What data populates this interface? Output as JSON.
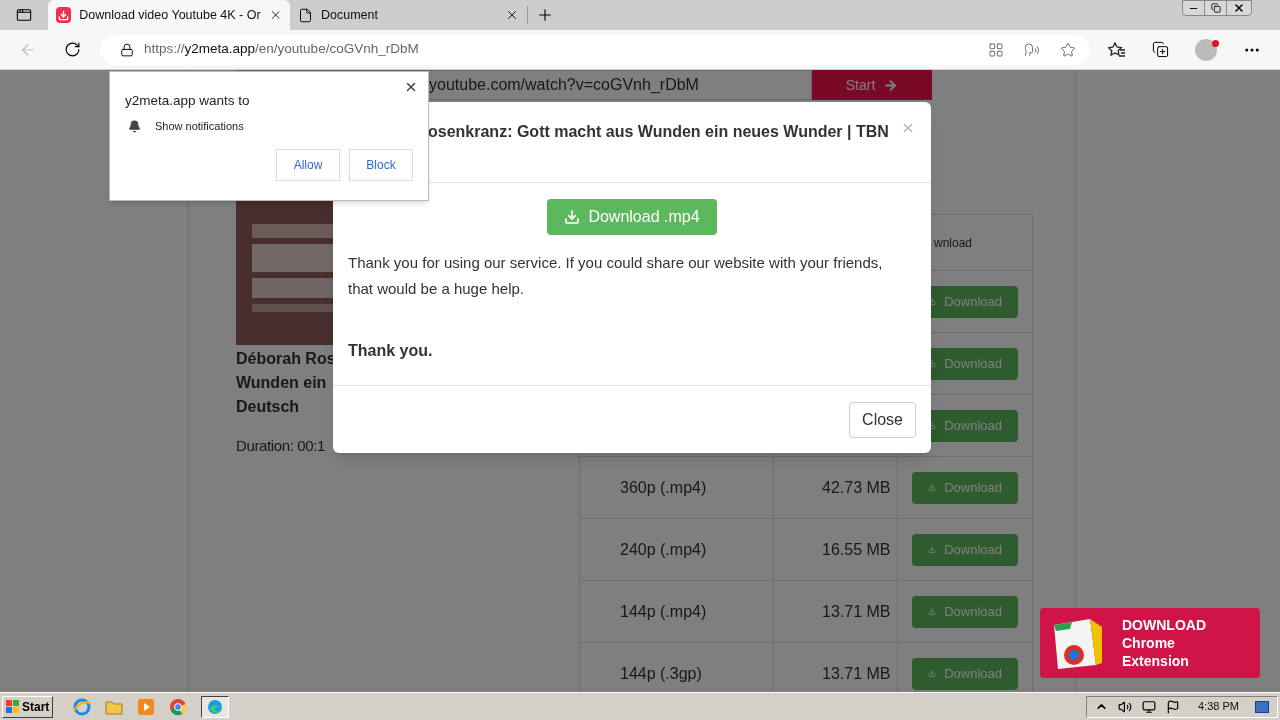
{
  "browser": {
    "tabs": [
      {
        "title": "Download video Youtube 4K - Or",
        "selected": true
      },
      {
        "title": "Document",
        "selected": false
      }
    ],
    "url": {
      "scheme": "https://",
      "host": "y2meta.app",
      "path": "/en/youtube/coGVnh_rDbM"
    }
  },
  "page": {
    "search": {
      "value": "youtube.com/watch?v=coGVnh_rDbM"
    },
    "start_button": "Start",
    "video": {
      "kind": "picture",
      "title_lines": [
        "Déborah Ros",
        "Wunden ein",
        "Deutsch"
      ],
      "duration": "Duration: 00:1"
    },
    "table": {
      "column_3": "wnload",
      "rows": [
        {
          "button": "Download"
        },
        {
          "button": "Download"
        },
        {
          "button": "Download"
        },
        {
          "quality": "360p (.mp4)",
          "size": "42.73 MB",
          "button": "Download"
        },
        {
          "quality": "240p (.mp4)",
          "size": "16.55 MB",
          "button": "Download"
        },
        {
          "quality": "144p (.mp4)",
          "size": "13.71 MB",
          "button": "Download"
        },
        {
          "quality": "144p (.3gp)",
          "size": "13.71 MB",
          "button": "Download"
        }
      ]
    }
  },
  "modal": {
    "title": "osenkranz: Gott macht aus Wunden ein neues Wunder | TBN",
    "download_button": "Download .mp4",
    "message": "Thank you for using our service. If you could share our website with your friends, that would be a huge help.",
    "thanks": "Thank you.",
    "close_button": "Close"
  },
  "notification": {
    "title": "y2meta.app wants to",
    "permission": "Show notifications",
    "buttons": [
      "Allow",
      "Block"
    ]
  },
  "ad": {
    "text": "DOWNLOAD Chrome Extension"
  },
  "taskbar": {
    "start": "Start",
    "clock": "4:38 PM"
  }
}
